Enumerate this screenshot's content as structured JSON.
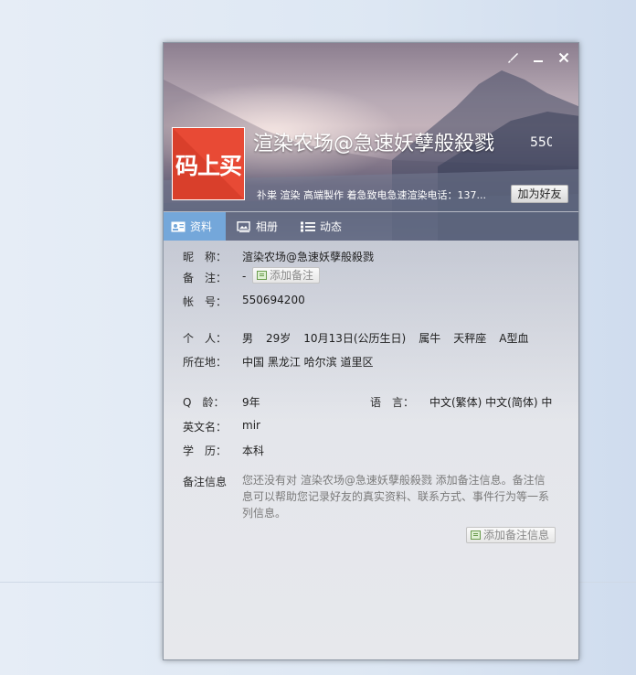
{
  "window": {
    "nickname": "渲染农场@急速妖孽般殺戮",
    "id_short": "550",
    "signature": "䃼粜 渲染 高端製作 着急致电急速渲染电话：137...",
    "add_friend_label": "加为好友",
    "avatar_text": "码上买"
  },
  "tabs": [
    {
      "label": "资料",
      "icon": "profile-card-icon",
      "active": true
    },
    {
      "label": "相册",
      "icon": "photo-album-icon",
      "active": false
    },
    {
      "label": "动态",
      "icon": "feed-list-icon",
      "active": false
    }
  ],
  "profile": {
    "nickname_label": "昵　称：",
    "nickname_value": "渲染农场@急速妖孽般殺戮",
    "remark_label": "备　注：",
    "remark_value": "-",
    "add_remark_label": "添加备注",
    "account_label": "帐　号：",
    "account_value": "550694200",
    "personal_label": "个　人：",
    "personal_values": [
      "男",
      "29岁",
      "10月13日(公历生日)",
      "属牛",
      "天秤座",
      "A型血"
    ],
    "location_label": "所在地：",
    "location_value": "中国 黑龙江 哈尔滨 道里区",
    "qage_label": "Q　龄：",
    "qage_value": "9年",
    "language_label": "语　言：",
    "language_value": "中文(繁体)  中文(简体)  中",
    "english_label": "英文名：",
    "english_value": "mir",
    "education_label": "学　历：",
    "education_value": "本科",
    "remark_info_label": "备注信息",
    "remark_info_text": "您还没有对 渲染农场@急速妖孽般殺戮 添加备注信息。备注信息可以帮助您记录好友的真实资料、联系方式、事件行为等一系列信息。",
    "add_remark_info_label": "添加备注信息"
  },
  "colors": {
    "tab_active": "#74a7da",
    "avatar_bg": "#e84a35"
  }
}
